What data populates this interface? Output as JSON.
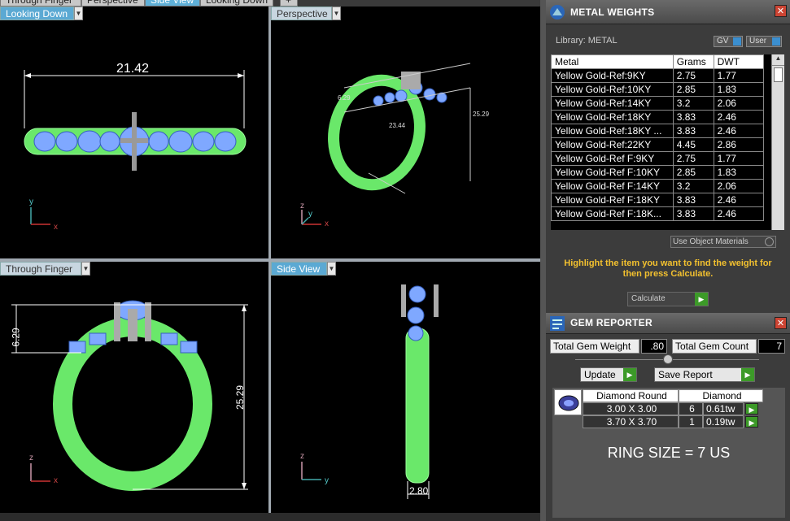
{
  "tabs": [
    "Through Finger",
    "Perspective",
    "Side View",
    "Looking Down",
    "+"
  ],
  "viewports": {
    "top_left": {
      "label": "Looking Down",
      "dimension": "21.42",
      "axis_v": "y",
      "axis_h": "x"
    },
    "top_right": {
      "label": "Perspective",
      "dim1": "6.29",
      "dim2": "25.29",
      "dim3": "23.44",
      "axis_v": "z",
      "axis_h": "x",
      "axis_d": "y"
    },
    "bottom_left": {
      "label": "Through Finger",
      "dim_small": "6.29",
      "dim_large": "25.29",
      "axis_v": "z",
      "axis_h": "x"
    },
    "bottom_right": {
      "label": "Side View",
      "dimension": "2.80",
      "axis_v": "z",
      "axis_h": "y"
    }
  },
  "metal_weights": {
    "title": "METAL WEIGHTS",
    "library_label": "Library: METAL",
    "gv_label": "GV",
    "user_label": "User",
    "columns": [
      "Metal",
      "Grams",
      "DWT"
    ],
    "rows": [
      [
        "Yellow Gold-Ref:9KY",
        "2.75",
        "1.77"
      ],
      [
        "Yellow Gold-Ref:10KY",
        "2.85",
        "1.83"
      ],
      [
        "Yellow Gold-Ref:14KY",
        "3.2",
        "2.06"
      ],
      [
        "Yellow Gold-Ref:18KY",
        "3.83",
        "2.46"
      ],
      [
        "Yellow Gold-Ref:18KY ...",
        "3.83",
        "2.46"
      ],
      [
        "Yellow Gold-Ref:22KY",
        "4.45",
        "2.86"
      ],
      [
        "Yellow Gold-Ref F:9KY",
        "2.75",
        "1.77"
      ],
      [
        "Yellow Gold-Ref F:10KY",
        "2.85",
        "1.83"
      ],
      [
        "Yellow Gold-Ref F:14KY",
        "3.2",
        "2.06"
      ],
      [
        "Yellow Gold-Ref F:18KY",
        "3.83",
        "2.46"
      ],
      [
        "Yellow Gold-Ref F:18K...",
        "3.83",
        "2.46"
      ]
    ],
    "use_object_materials": "Use Object Materials",
    "hint": "Highlight the item you want to find the weight for then press Calculate.",
    "calculate": "Calculate"
  },
  "gem_reporter": {
    "title": "GEM REPORTER",
    "total_weight_label": "Total Gem Weight",
    "total_weight": ".80",
    "total_count_label": "Total Gem Count",
    "total_count": "7",
    "update": "Update",
    "save_report": "Save Report",
    "header_shape": "Diamond Round",
    "header_type": "Diamond",
    "rows": [
      {
        "size": "3.00 X 3.00",
        "count": "6",
        "weight": "0.61tw"
      },
      {
        "size": "3.70 X 3.70",
        "count": "1",
        "weight": "0.19tw"
      }
    ],
    "ring_size": "RING SIZE = 7 US"
  },
  "colors": {
    "accent_blue": "#5ba9d3",
    "wire_green": "#7cf07c",
    "gem_blue": "#7fa8ff",
    "hint_yellow": "#f3c12f",
    "button_green": "#3c9a28"
  }
}
